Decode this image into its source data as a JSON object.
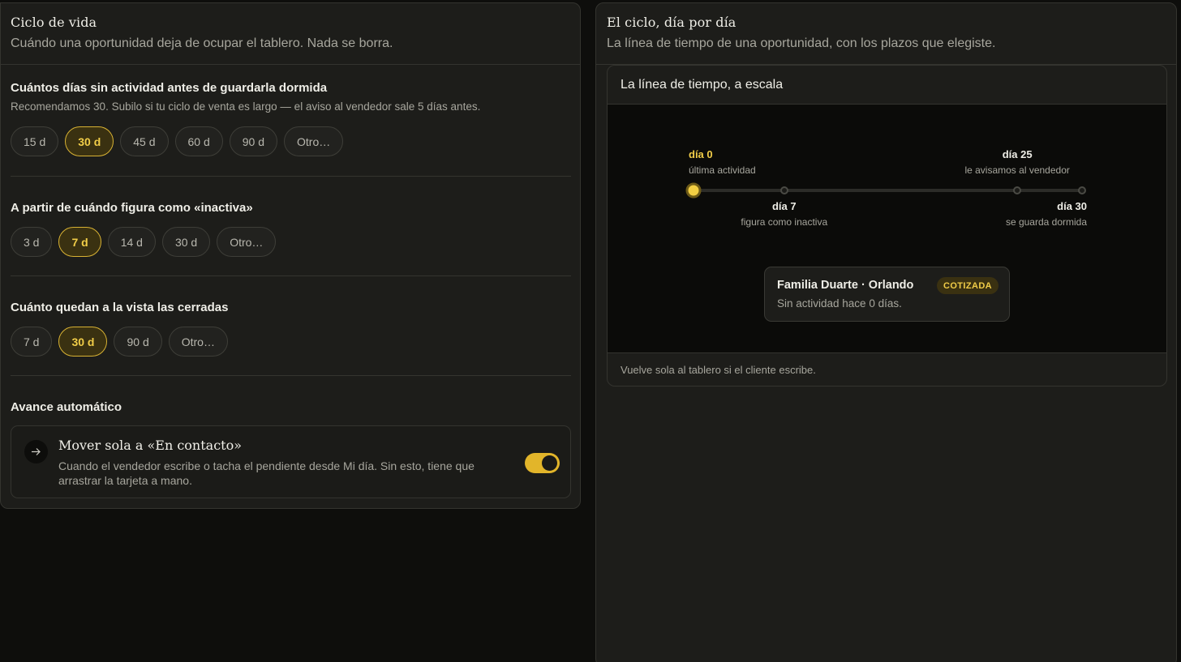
{
  "left": {
    "title": "Ciclo de vida",
    "subtitle": "Cuándo una oportunidad deja de ocupar el tablero. Nada se borra.",
    "dormant": {
      "title": "Cuántos días sin actividad antes de guardarla dormida",
      "help": "Recomendamos 30. Subilo si tu ciclo de venta es largo — el aviso al vendedor sale 5 días antes.",
      "options": [
        "15 d",
        "30 d",
        "45 d",
        "60 d",
        "90 d",
        "Otro…"
      ],
      "selected": "30 d"
    },
    "inactive": {
      "title": "A partir de cuándo figura como «inactiva»",
      "options": [
        "3 d",
        "7 d",
        "14 d",
        "30 d",
        "Otro…"
      ],
      "selected": "7 d"
    },
    "closed": {
      "title": "Cuánto quedan a la vista las cerradas",
      "options": [
        "7 d",
        "30 d",
        "90 d",
        "Otro…"
      ],
      "selected": "30 d"
    },
    "auto": {
      "title": "Avance automático",
      "card_title": "Mover sola a «En contacto»",
      "card_desc": "Cuando el vendedor escribe o tacha el pendiente desde Mi día. Sin esto, tiene que arrastrar la tarjeta a mano.",
      "icon": "arrow-right-icon",
      "enabled": true
    }
  },
  "right": {
    "title": "El ciclo, día por día",
    "subtitle": "La línea de tiempo de una oportunidad, con los plazos que elegiste.",
    "timeline": {
      "heading": "La línea de tiempo, a escala",
      "max_day": 30,
      "markers": [
        {
          "day": 0,
          "label": "día 0",
          "note": "última actividad",
          "position": "above",
          "active": true
        },
        {
          "day": 7,
          "label": "día 7",
          "note": "figura como inactiva",
          "position": "below",
          "active": false
        },
        {
          "day": 25,
          "label": "día 25",
          "note": "le avisamos al vendedor",
          "position": "above",
          "active": false
        },
        {
          "day": 30,
          "label": "día 30",
          "note": "se guarda dormida",
          "position": "below",
          "active": false
        }
      ],
      "card": {
        "name": "Familia Duarte · Orlando",
        "badge": "COTIZADA",
        "desc": "Sin actividad hace 0 días."
      },
      "footer": "Vuelve sola al tablero si el cliente escribe."
    }
  },
  "colors": {
    "accent": "#f1cd48",
    "toggle_on": "#e2b52a",
    "background": "#0e0e0c",
    "panel": "#1d1d1a"
  }
}
